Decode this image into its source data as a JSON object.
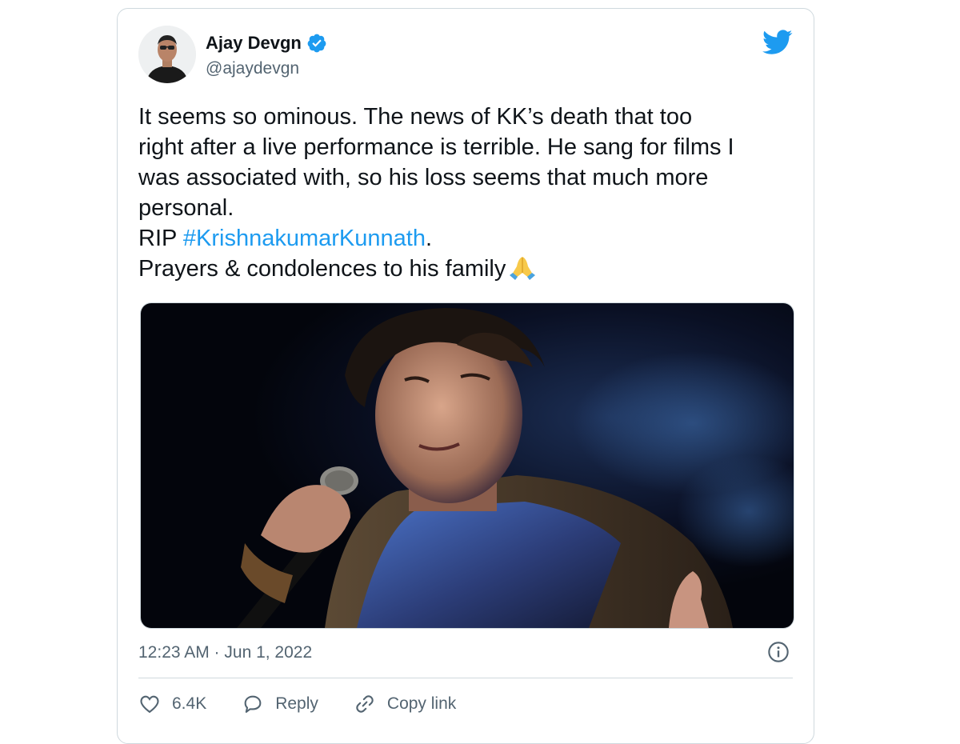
{
  "author": {
    "name": "Ajay Devgn",
    "handle": "@ajaydevgn"
  },
  "icons": {
    "verified": "verified-badge-icon",
    "brand": "twitter-bird-icon",
    "emoji": "folded-hands-icon",
    "info": "info-icon",
    "like": "heart-icon",
    "reply": "speech-bubble-icon",
    "copy": "link-icon"
  },
  "colors": {
    "accent": "#1d9bf0",
    "text": "#0f1419",
    "secondary": "#536471",
    "border": "#cfd9de"
  },
  "tweet": {
    "line1": "It seems so ominous. The news of KK’s death that too",
    "line2": "right after a live performance is terrible. He sang for films I",
    "line3": "was associated with, so his loss seems that much more",
    "line4": "personal.",
    "rip_prefix": "RIP ",
    "hashtag": "#KrishnakumarKunnath",
    "rip_suffix": ".",
    "line6": "Prayers & condolences to his family"
  },
  "timestamp": "12:23 AM · Jun 1, 2022",
  "actions": {
    "like_count": "6.4K",
    "reply_label": "Reply",
    "copy_label": "Copy link"
  }
}
